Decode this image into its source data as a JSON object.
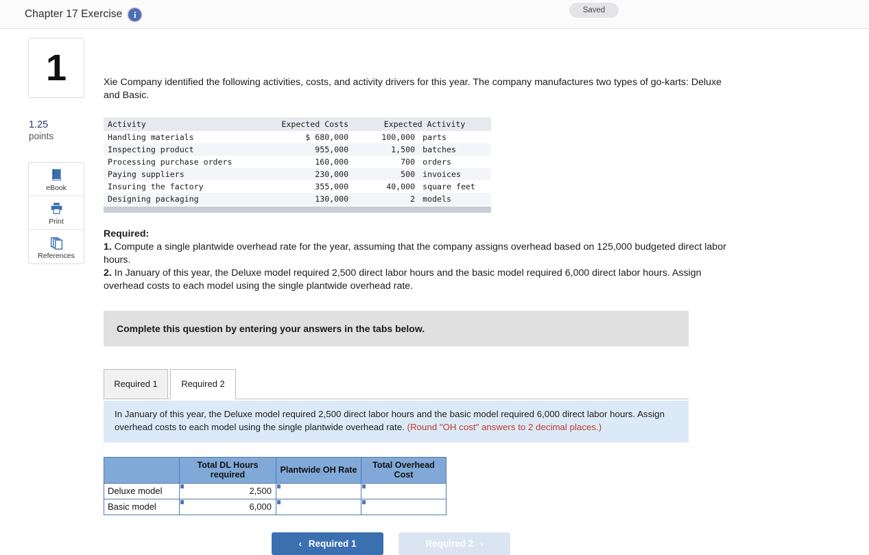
{
  "topbar": {
    "title": "Chapter 17 Exercise",
    "info_icon": "info-icon",
    "status": "Saved"
  },
  "rail": {
    "question_number": "1",
    "points_value": "1.25",
    "points_label": "points",
    "tools": [
      {
        "icon": "ebook-icon",
        "label": "eBook"
      },
      {
        "icon": "print-icon",
        "label": "Print"
      },
      {
        "icon": "references-icon",
        "label": "References"
      }
    ]
  },
  "main": {
    "intro": "Xie Company identified the following activities, costs, and activity drivers for this year. The company manufactures two types of go-karts: Deluxe and Basic.",
    "activity_table": {
      "headers": [
        "Activity",
        "Expected Costs",
        "Expected Activity"
      ],
      "rows": [
        {
          "activity": "Handling materials",
          "cost": "$ 680,000",
          "qty": "100,000",
          "unit": "parts"
        },
        {
          "activity": "Inspecting product",
          "cost": "955,000",
          "qty": "1,500",
          "unit": "batches"
        },
        {
          "activity": "Processing purchase orders",
          "cost": "160,000",
          "qty": "700",
          "unit": "orders"
        },
        {
          "activity": "Paying suppliers",
          "cost": "230,000",
          "qty": "500",
          "unit": "invoices"
        },
        {
          "activity": "Insuring the factory",
          "cost": "355,000",
          "qty": "40,000",
          "unit": "square feet"
        },
        {
          "activity": "Designing packaging",
          "cost": "130,000",
          "qty": "2",
          "unit": "models"
        }
      ]
    },
    "required_heading": "Required:",
    "required_1_number": "1.",
    "required_1_text": " Compute a single plantwide overhead rate for the year, assuming that the company assigns overhead based on 125,000 budgeted direct labor hours.",
    "required_2_number": "2.",
    "required_2_text": " In January of this year, the Deluxe model required 2,500 direct labor hours and the basic model required 6,000 direct labor hours. Assign overhead costs to each model using the single plantwide overhead rate.",
    "banner": "Complete this question by entering your answers in the tabs below.",
    "tabs": [
      {
        "label": "Required 1",
        "active": false
      },
      {
        "label": "Required 2",
        "active": true
      }
    ],
    "blue_panel": {
      "text": "In January of this year, the Deluxe model required 2,500 direct labor hours and the basic model required 6,000 direct labor hours. Assign overhead costs to each model using the single plantwide overhead rate. ",
      "round_note": "(Round \"OH cost\" answers to 2 decimal places.)"
    },
    "answer_table": {
      "corner": "",
      "headers": [
        "Total DL Hours required",
        "Plantwide OH Rate",
        "Total Overhead Cost"
      ],
      "rows": [
        {
          "label": "Deluxe model",
          "dl_hours": "2,500",
          "oh_rate": "",
          "total_oh": ""
        },
        {
          "label": "Basic model",
          "dl_hours": "6,000",
          "oh_rate": "",
          "total_oh": ""
        }
      ]
    },
    "nav": {
      "prev_label": "Required 1",
      "prev_chevron": "‹",
      "next_label": "Required 2",
      "next_chevron": "›"
    }
  },
  "colors": {
    "accent_blue": "#3a6fb0",
    "table_header_blue": "#81a9d8",
    "panel_blue": "#dceaf7",
    "note_red": "#c0392b",
    "banner_gray": "#e0e0e0"
  }
}
